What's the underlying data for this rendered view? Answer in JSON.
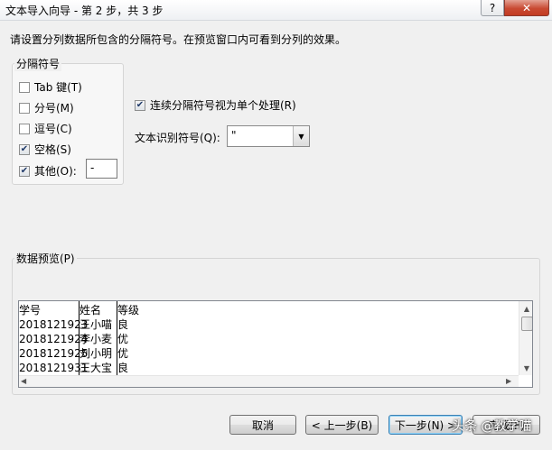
{
  "window": {
    "title": "文本导入向导 - 第 2 步，共 3 步",
    "help_label": "?",
    "close_label": "✕"
  },
  "instruction": "请设置分列数据所包含的分隔符号。在预览窗口内可看到分列的效果。",
  "delimiters": {
    "legend": "分隔符号",
    "options": [
      {
        "label": "Tab 键(T)",
        "checked": false
      },
      {
        "label": "分号(M)",
        "checked": false
      },
      {
        "label": "逗号(C)",
        "checked": false
      },
      {
        "label": "空格(S)",
        "checked": true
      },
      {
        "label": "其他(O):",
        "checked": true
      }
    ],
    "other_value": "-"
  },
  "consecutive": {
    "label": "连续分隔符号视为单个处理(R)",
    "checked": true
  },
  "text_qualifier": {
    "label": "文本识别符号(Q):",
    "value": "\""
  },
  "preview": {
    "legend": "数据预览(P)",
    "columns": [
      "学号",
      "姓名",
      "等级"
    ],
    "rows": [
      [
        "2018121923",
        "王小喵",
        "良"
      ],
      [
        "2018121924",
        "李小麦",
        "优"
      ],
      [
        "2018121925",
        "刘小明",
        "优"
      ],
      [
        "2018121931",
        "王大宝",
        "良"
      ]
    ]
  },
  "buttons": {
    "cancel": "取消",
    "back": "< 上一步(B)",
    "next": "下一步(N) >",
    "finish": "完成(F)"
  },
  "watermark": "头条 @教学喵"
}
